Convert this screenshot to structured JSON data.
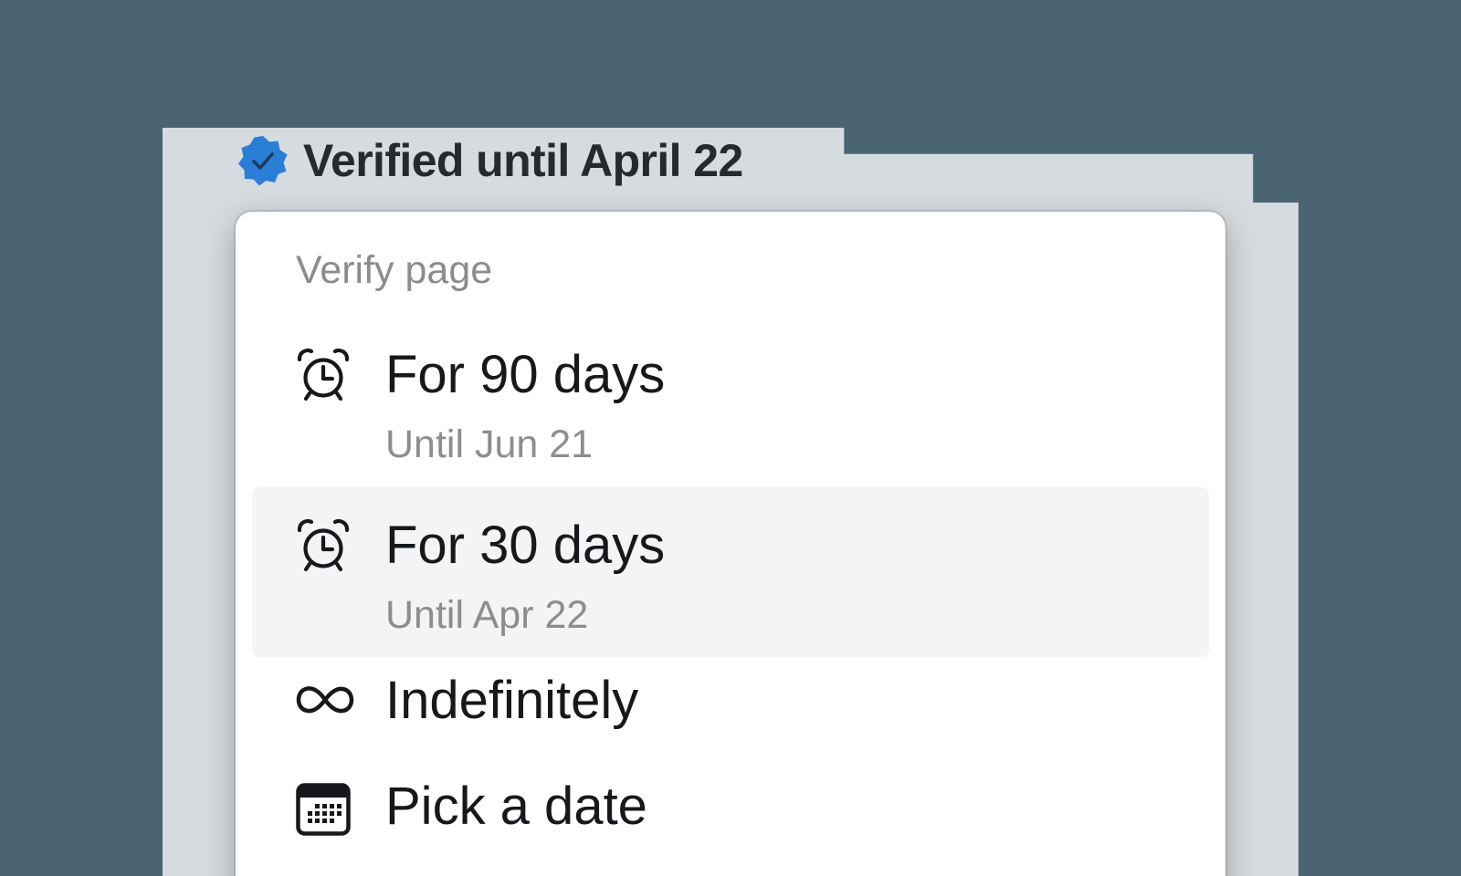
{
  "badge": {
    "label": "Verified until April 22",
    "icon": "verified-check-icon",
    "color": "#2a7ed6"
  },
  "menu": {
    "heading": "Verify page",
    "items": [
      {
        "label": "For 90 days",
        "sublabel": "Until Jun 21",
        "icon": "alarm-clock-icon",
        "highlighted": false
      },
      {
        "label": "For 30 days",
        "sublabel": "Until Apr 22",
        "icon": "alarm-clock-icon",
        "highlighted": true
      },
      {
        "label": "Indefinitely",
        "icon": "infinity-icon",
        "highlighted": false
      },
      {
        "label": "Pick a date",
        "icon": "calendar-icon",
        "highlighted": false
      }
    ]
  },
  "colors": {
    "background": "#4a6472",
    "menu_background": "#ffffff",
    "highlight": "#f4f3f5",
    "primary_text": "#16181b",
    "secondary_text": "#8f8d8b"
  }
}
